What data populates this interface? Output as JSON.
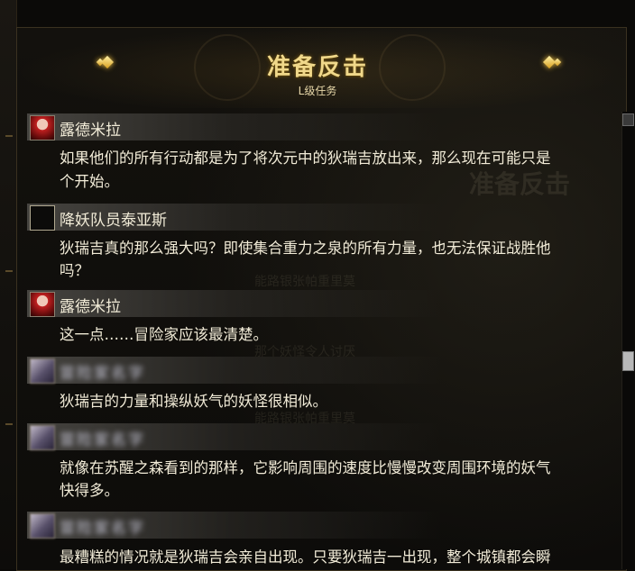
{
  "window": {
    "title": "准备反击",
    "subtitle": "L级任务"
  },
  "background_watermark": {
    "title": "准备反击",
    "fragments": [
      "能路银张帕重里莫",
      "那个妖怪令人讨厌",
      "能路银张帕重里莫"
    ]
  },
  "dialogues": [
    {
      "speaker": "露德米拉",
      "avatar": "red-hair-portrait",
      "lines": [
        "如果他们的所有行动都是为了将次元中的狄瑞吉放出来，那么现在可能只是",
        "个开始。"
      ]
    },
    {
      "speaker": "降妖队员泰亚斯",
      "avatar": "empty-portrait",
      "lines": [
        "狄瑞吉真的那么强大吗？即使集合重力之泉的所有力量，也无法保证战胜他",
        "吗？"
      ]
    },
    {
      "speaker": "露德米拉",
      "avatar": "red-hair-portrait",
      "lines": [
        "这一点……冒险家应该最清楚。"
      ]
    },
    {
      "speaker": "冒险家名字",
      "avatar": "blurred-portrait",
      "lines": [
        "狄瑞吉的力量和操纵妖气的妖怪很相似。"
      ]
    },
    {
      "speaker": "冒险家名字",
      "avatar": "blurred-portrait",
      "lines": [
        "就像在苏醒之森看到的那样，它影响周围的速度比慢慢改变周围环境的妖气",
        "快得多。"
      ]
    },
    {
      "speaker": "冒险家名字",
      "avatar": "blurred-portrait",
      "lines": [
        "最糟糕的情况就是狄瑞吉会亲自出现。只要狄瑞吉一出现，整个城镇都会瞬"
      ]
    }
  ],
  "colors": {
    "title_gold": "#f0d88a",
    "text": "#f2ecd8",
    "ornament": "#d8a020"
  }
}
